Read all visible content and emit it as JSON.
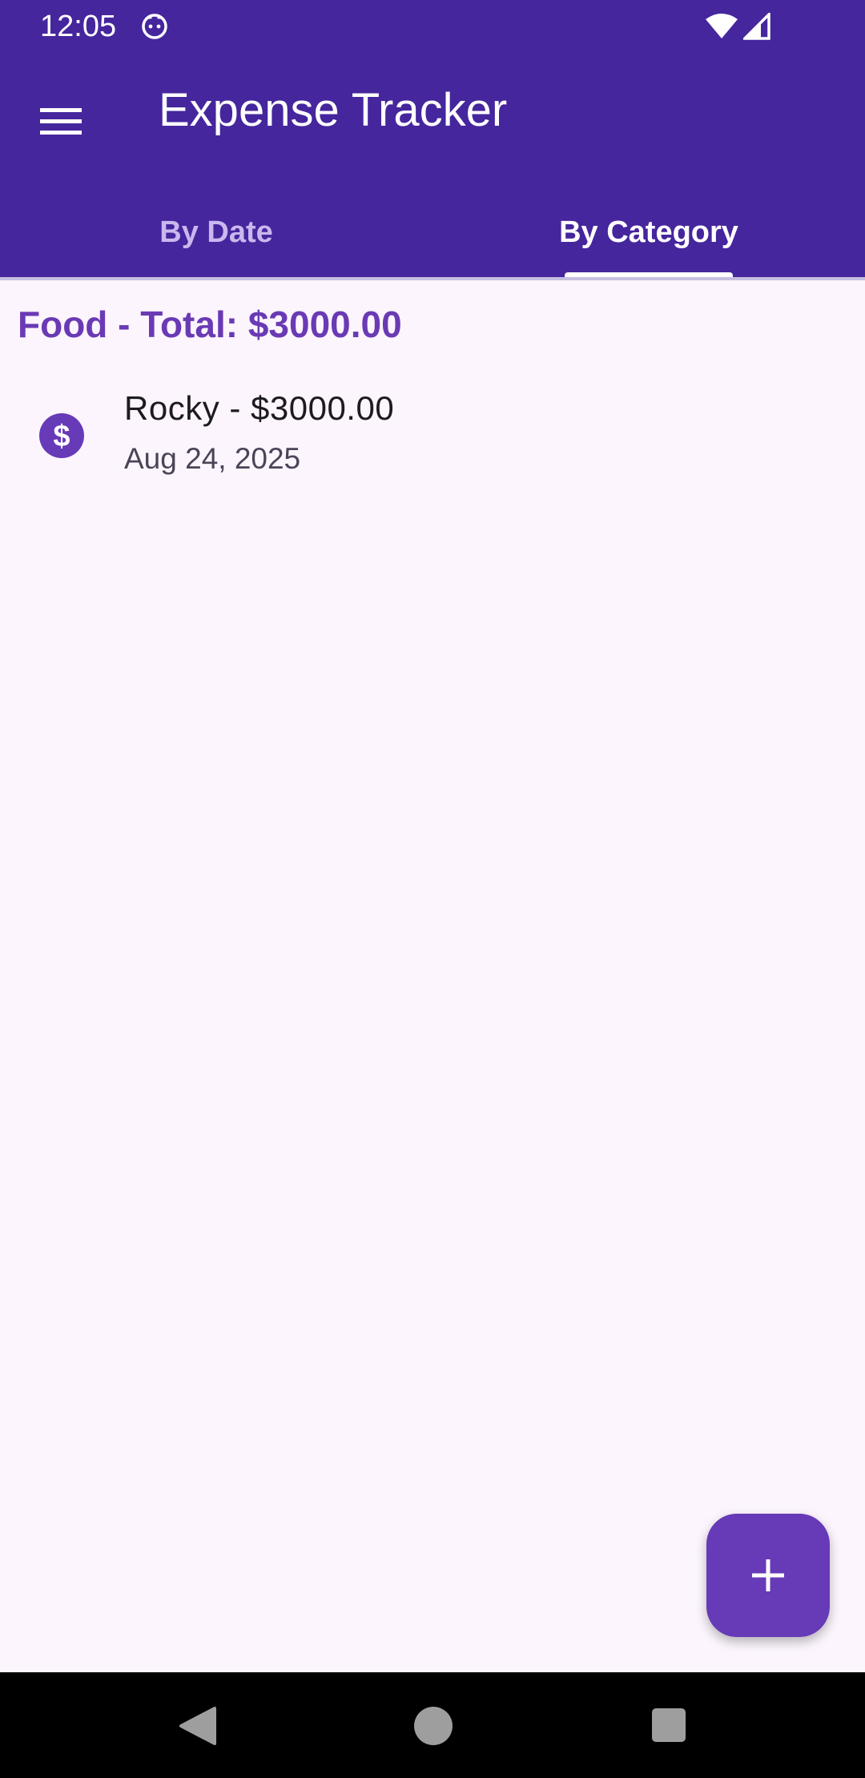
{
  "status_bar": {
    "time": "12:05",
    "icons": [
      "cat-notification-icon",
      "wifi-icon",
      "signal-icon"
    ]
  },
  "app_bar": {
    "title": "Expense Tracker",
    "menu_icon": "hamburger-menu-icon",
    "background_color": "#45269d"
  },
  "tabs": [
    {
      "label": "By Date",
      "active": false
    },
    {
      "label": "By Category",
      "active": true
    }
  ],
  "category_group": {
    "header": "Food - Total: $3000.00",
    "items": [
      {
        "icon": "dollar-circle-icon",
        "title": "Rocky - $3000.00",
        "date": "Aug 24, 2025"
      }
    ]
  },
  "fab": {
    "icon": "plus-icon",
    "color": "#673ab7"
  },
  "nav_bar": {
    "icons": [
      "back-icon",
      "home-icon",
      "recents-icon"
    ]
  },
  "colors": {
    "accent": "#6a3ab4",
    "background": "#fcf5fd"
  }
}
